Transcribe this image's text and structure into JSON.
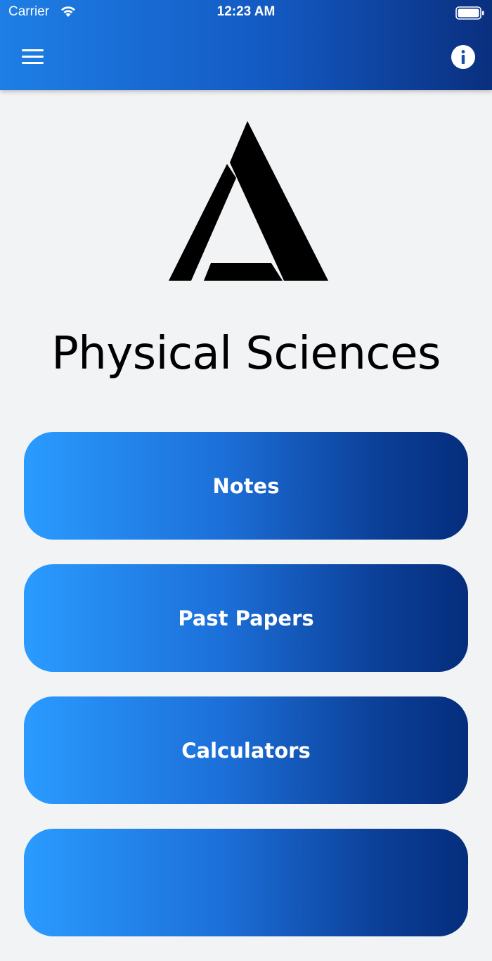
{
  "status_bar": {
    "carrier": "Carrier",
    "time": "12:23 AM"
  },
  "header": {
    "menu_icon": "hamburger-menu-icon",
    "info_icon": "info-icon"
  },
  "app": {
    "logo_icon": "triangle-logo-icon",
    "title": "Physical Sciences"
  },
  "menu": {
    "items": [
      {
        "label": "Notes"
      },
      {
        "label": "Past Papers"
      },
      {
        "label": "Calculators"
      },
      {
        "label": ""
      }
    ]
  },
  "colors": {
    "header_start": "#1e7fe6",
    "header_end": "#0a2f7f",
    "button_start": "#2a9bff",
    "button_end": "#052d7c",
    "background": "#f2f3f5"
  }
}
